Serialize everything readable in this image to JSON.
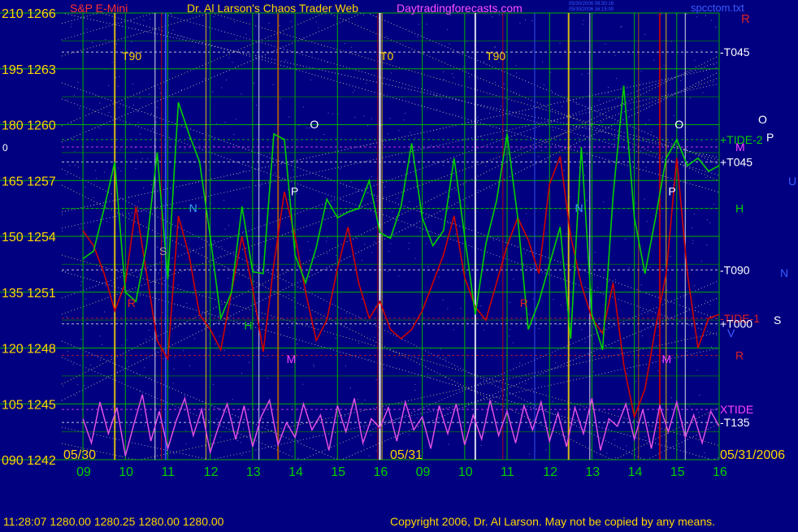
{
  "header": {
    "symbol": "S&P E-Mini",
    "title": "Dr. Al Larson's Chaos Trader Web",
    "website": "Daytradingforecasts.com",
    "file": "spcctom.txt",
    "stamp_line1": "05/30/2006 08:30:16",
    "stamp_line2": "05/30/2006 16:15:00"
  },
  "footer": {
    "quote": "11:28:07   1280.00  1280.25  1280.00  1280.00",
    "copyright": "Copyright 2006, Dr. Al Larson. May not be copied by any means."
  },
  "colors": {
    "background": "#000080",
    "price_line": "#d00000",
    "tide_line": "#00d000",
    "xtide_line": "#e050e0",
    "grid_green": "#00b000",
    "gold": "#ffd700",
    "white": "#ffffff",
    "magenta": "#ff40ff",
    "red_label": "#e02020",
    "blue_label": "#3a5cff"
  },
  "chart_data": {
    "type": "line",
    "y_axis_labels": [
      {
        "angle": "210",
        "price": "1266"
      },
      {
        "angle": "195",
        "price": "1263"
      },
      {
        "angle": "180",
        "price": "1260"
      },
      {
        "angle": "165",
        "price": "1257"
      },
      {
        "angle": "150",
        "price": "1254"
      },
      {
        "angle": "135",
        "price": "1251"
      },
      {
        "angle": "120",
        "price": "1248"
      },
      {
        "angle": "105",
        "price": "1245"
      },
      {
        "angle": "090",
        "price": "1242"
      }
    ],
    "ylim": [
      1242,
      1266
    ],
    "x_ticks": [
      "09",
      "10",
      "11",
      "12",
      "13",
      "14",
      "15",
      "16",
      "09",
      "10",
      "11",
      "12",
      "13",
      "14",
      "15",
      "16"
    ],
    "date_labels": [
      "05/30",
      "05/31",
      "05/31/2006"
    ],
    "left_marker": "0",
    "top_labels": [
      "T90",
      "T0",
      "T90",
      "R"
    ],
    "right_labels": [
      {
        "text": "-T045",
        "color": "white",
        "price": 1263.9
      },
      {
        "text": "+TIDE-2",
        "color": "green",
        "price": 1259.2
      },
      {
        "text": "M",
        "color": "magenta",
        "price": 1258.8
      },
      {
        "text": "+T045",
        "color": "white",
        "price": 1258.0
      },
      {
        "text": "H",
        "color": "green",
        "price": 1255.5
      },
      {
        "text": "-T090",
        "color": "white",
        "price": 1252.2
      },
      {
        "text": "-TIDE-1",
        "color": "red",
        "price": 1249.6
      },
      {
        "text": "+T000",
        "color": "white",
        "price": 1249.3
      },
      {
        "text": "R",
        "color": "red",
        "price": 1247.6
      },
      {
        "text": "XTIDE",
        "color": "magenta",
        "price": 1244.7
      },
      {
        "text": "-T135",
        "color": "white",
        "price": 1244.0
      }
    ],
    "far_right_letters": [
      "O",
      "P",
      "U",
      "N",
      "S",
      "V"
    ],
    "chart_letters": [
      {
        "text": "N",
        "x": 11.5,
        "price": 1255.3,
        "color": "blue"
      },
      {
        "text": "S",
        "x": 10.8,
        "price": 1253.0,
        "color": "gray"
      },
      {
        "text": "R",
        "x": 10.05,
        "price": 1250.2,
        "color": "red"
      },
      {
        "text": "H",
        "x": 12.8,
        "price": 1249.0,
        "color": "green"
      },
      {
        "text": "O",
        "x": 14.35,
        "price": 1259.8,
        "color": "white"
      },
      {
        "text": "P",
        "x": 13.9,
        "price": 1256.2,
        "color": "white"
      },
      {
        "text": "M",
        "x": 13.8,
        "price": 1247.2,
        "color": "magenta"
      },
      {
        "text": "N",
        "x": 20.6,
        "price": 1255.3,
        "color": "blue"
      },
      {
        "text": "R",
        "x": 19.3,
        "price": 1250.2,
        "color": "red"
      },
      {
        "text": "O",
        "x": 22.95,
        "price": 1259.8,
        "color": "white"
      },
      {
        "text": "P",
        "x": 22.8,
        "price": 1256.2,
        "color": "white"
      },
      {
        "text": "M",
        "x": 22.65,
        "price": 1247.2,
        "color": "magenta"
      }
    ],
    "series": [
      {
        "name": "price",
        "color": "#d00000",
        "x": [
          9.0,
          9.25,
          9.5,
          9.75,
          10.0,
          10.25,
          10.5,
          10.75,
          11.0,
          11.25,
          11.5,
          11.75,
          12.0,
          12.25,
          12.5,
          12.75,
          13.0,
          13.25,
          13.5,
          13.75,
          14.0,
          14.25,
          14.5,
          14.75,
          15.0,
          15.25,
          15.5,
          15.75,
          16.0,
          16.25,
          16.5,
          16.75,
          17.0,
          17.25,
          17.5,
          17.75,
          18.0,
          18.25,
          18.5,
          18.75,
          19.0,
          19.25,
          19.5,
          19.75,
          20.0,
          20.25,
          20.5,
          20.75,
          21.0,
          21.25,
          21.5,
          21.75,
          22.0,
          22.25,
          22.5,
          22.75,
          23.0,
          23.25,
          23.5,
          23.75,
          24.0
        ],
        "values": [
          1254.3,
          1253.5,
          1252.0,
          1250.0,
          1251.5,
          1255.6,
          1252.0,
          1248.4,
          1247.4,
          1255.1,
          1253.0,
          1249.8,
          1249.0,
          1247.9,
          1251.0,
          1254.0,
          1251.2,
          1247.8,
          1252.5,
          1256.4,
          1254.0,
          1251.0,
          1248.4,
          1249.5,
          1252.3,
          1254.5,
          1251.5,
          1249.6,
          1250.5,
          1249.0,
          1248.5,
          1249.0,
          1250.0,
          1251.5,
          1253.0,
          1255.1,
          1251.8,
          1250.2,
          1249.5,
          1251.5,
          1253.5,
          1255.0,
          1253.8,
          1252.0,
          1256.8,
          1258.3,
          1254.0,
          1251.4,
          1249.6,
          1248.8,
          1251.5,
          1247.1,
          1244.3,
          1245.8,
          1249.1,
          1252.0,
          1258.2,
          1252.0,
          1248.0,
          1249.6,
          1249.8
        ]
      },
      {
        "name": "tide",
        "color": "#00d000",
        "x": [
          9.0,
          9.25,
          9.5,
          9.75,
          10.0,
          10.25,
          10.5,
          10.75,
          11.0,
          11.25,
          11.5,
          11.75,
          12.0,
          12.25,
          12.5,
          12.75,
          13.0,
          13.25,
          13.5,
          13.75,
          14.0,
          14.25,
          14.5,
          14.75,
          15.0,
          15.25,
          15.5,
          15.75,
          16.0,
          16.25,
          16.5,
          16.75,
          17.0,
          17.25,
          17.5,
          17.75,
          18.0,
          18.25,
          18.5,
          18.75,
          19.0,
          19.25,
          19.5,
          19.75,
          20.0,
          20.25,
          20.5,
          20.75,
          21.0,
          21.25,
          21.5,
          21.75,
          22.0,
          22.25,
          22.5,
          22.75,
          23.0,
          23.25,
          23.5,
          23.75,
          24.0
        ],
        "values": [
          1252.8,
          1253.2,
          1255.5,
          1258.0,
          1251.0,
          1250.5,
          1253.5,
          1258.5,
          1251.7,
          1261.2,
          1259.5,
          1258.0,
          1254.0,
          1249.6,
          1251.0,
          1255.6,
          1252.1,
          1252.0,
          1259.5,
          1259.2,
          1253.0,
          1251.5,
          1253.4,
          1256.0,
          1255.0,
          1255.3,
          1255.5,
          1257.0,
          1254.2,
          1253.9,
          1255.6,
          1259.0,
          1255.0,
          1253.5,
          1254.3,
          1258.2,
          1254.0,
          1249.8,
          1253.6,
          1255.9,
          1259.5,
          1255.0,
          1249.0,
          1250.5,
          1252.5,
          1254.5,
          1248.5,
          1258.8,
          1249.8,
          1247.9,
          1256.2,
          1262.1,
          1255.0,
          1252.0,
          1255.0,
          1258.2,
          1259.2,
          1257.8,
          1258.2,
          1257.5,
          1257.8
        ]
      },
      {
        "name": "xtide",
        "color": "#e050e0",
        "x": [
          9.0,
          9.2,
          9.4,
          9.6,
          9.8,
          10.0,
          10.2,
          10.4,
          10.6,
          10.8,
          11.0,
          11.2,
          11.4,
          11.6,
          11.8,
          12.0,
          12.2,
          12.4,
          12.6,
          12.8,
          13.0,
          13.2,
          13.4,
          13.6,
          13.8,
          14.0,
          14.2,
          14.4,
          14.6,
          14.8,
          15.0,
          15.2,
          15.4,
          15.6,
          15.8,
          16.0,
          16.2,
          16.4,
          16.6,
          16.8,
          17.0,
          17.2,
          17.4,
          17.6,
          17.8,
          18.0,
          18.2,
          18.4,
          18.6,
          18.8,
          19.0,
          19.2,
          19.4,
          19.6,
          19.8,
          20.0,
          20.2,
          20.4,
          20.6,
          20.8,
          21.0,
          21.2,
          21.4,
          21.6,
          21.8,
          22.0,
          22.2,
          22.4,
          22.6,
          22.8,
          23.0,
          23.2,
          23.4,
          23.6,
          23.8,
          24.0
        ],
        "values": [
          1244.2,
          1242.9,
          1245.1,
          1243.4,
          1244.8,
          1242.2,
          1243.9,
          1245.5,
          1243.0,
          1244.6,
          1242.6,
          1244.1,
          1245.3,
          1243.3,
          1244.7,
          1242.4,
          1243.8,
          1245.0,
          1243.1,
          1244.9,
          1242.7,
          1244.3,
          1245.2,
          1242.8,
          1244.0,
          1243.2,
          1245.0,
          1243.6,
          1244.4,
          1242.5,
          1244.9,
          1243.5,
          1245.3,
          1242.9,
          1244.2,
          1243.7,
          1244.8,
          1243.0,
          1245.1,
          1243.6,
          1244.3,
          1242.6,
          1244.9,
          1243.4,
          1245.0,
          1242.8,
          1244.4,
          1243.1,
          1245.2,
          1243.3,
          1244.6,
          1242.9,
          1244.9,
          1243.6,
          1245.1,
          1243.0,
          1244.5,
          1242.7,
          1244.8,
          1243.4,
          1245.3,
          1242.5,
          1244.2,
          1243.8,
          1245.0,
          1243.1,
          1244.7,
          1242.6,
          1244.9,
          1243.5,
          1245.1,
          1243.2,
          1244.4,
          1242.9,
          1244.6,
          1243.8
        ]
      }
    ]
  }
}
